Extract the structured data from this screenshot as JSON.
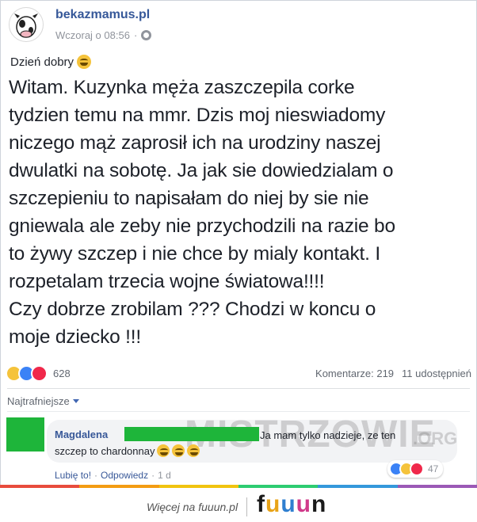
{
  "post": {
    "page_name": "bekazmamus.pl",
    "timestamp": "Wczoraj o 08:56",
    "greeting": "Dzień dobry",
    "body_lines": [
      "Witam. Kuzynka męża zaszczepila corke",
      "tydzien temu na mmr. Dzis moj nieswiadomy",
      "niczego mąż zaprosił ich na urodziny naszej",
      "dwulatki na sobotę. Ja jak sie dowiedzialam o",
      "szczepieniu to napisałam do niej by sie nie",
      "gniewala ale zeby nie przychodzili na razie bo",
      "to żywy szczep i nie chce by mialy kontakt. I",
      "rozpetalam trzecia wojne światowa!!!!",
      "Czy dobrze zrobilam ???  Chodzi w koncu o",
      "moje dziecko !!!"
    ],
    "reaction_count": "628",
    "comments_label": "Komentarze: 219",
    "shares_label": "11 udostępnień"
  },
  "comments_sort": {
    "label": "Najtrafniejsze"
  },
  "comment": {
    "author": "Magdalena",
    "text_line1": "Ja mam tylko nadzieje, ze ten",
    "text_line2": "szczep to chardonnay",
    "reaction_count": "47",
    "like_label": "Lubię to!",
    "reply_label": "Odpowiedz",
    "time": "1 d"
  },
  "watermark": {
    "text": "MISTRZOWIE",
    "suffix": ".ORG"
  },
  "footer": {
    "text": "Więcej na fuuun.pl",
    "logo_letters": [
      "f",
      "u",
      "u",
      "u",
      "n"
    ],
    "logo_colors": [
      "#1a1a1a",
      "#e8a317",
      "#2f7fd0",
      "#d03a8a",
      "#1a1a1a"
    ]
  },
  "colors": {
    "link": "#365899",
    "redaction": "#1eb53a",
    "rainbow": [
      "#e84c3d",
      "#f39c12",
      "#f1c40f",
      "#2ecc71",
      "#3498db",
      "#9b59b6"
    ]
  },
  "icons": [
    "globe-icon",
    "haha-emoji-icon",
    "like-reaction-icon",
    "love-reaction-icon",
    "caret-down-icon"
  ]
}
